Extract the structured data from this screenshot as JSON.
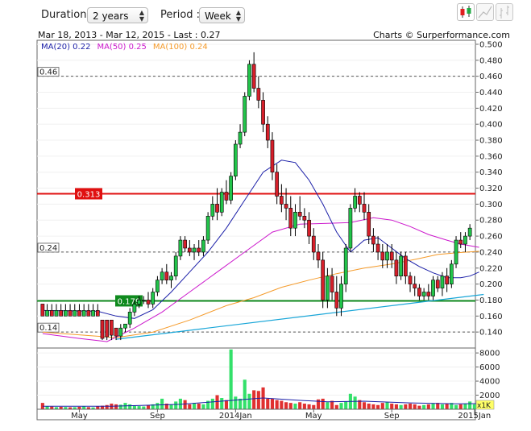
{
  "toolbar": {
    "duration_label": "Duration :",
    "duration_value": "2 years",
    "period_label": "Period :",
    "period_value": "Week",
    "chart_type_icons": [
      "candlestick-icon",
      "line-chart-icon",
      "bar-chart-icon"
    ]
  },
  "header": {
    "range_text": "Mar 18, 2013 - Mar 12, 2015 - Last : 0.27",
    "credit_text": "Charts © Surperformance.com"
  },
  "colors": {
    "up": "#22c44a",
    "down": "#d61f2a",
    "ma20": "#1b1fa8",
    "ma50": "#cc18cc",
    "ma100": "#f59b2b",
    "trend": "#19a6d8",
    "resistance": "#e01010",
    "support": "#0f8a1e"
  },
  "chart_data": {
    "type": "candlestick",
    "title": "",
    "legend": [
      {
        "name": "MA(20)",
        "value": "0.22",
        "color": "#1b1fa8"
      },
      {
        "name": "MA(50)",
        "value": "0.25",
        "color": "#cc18cc"
      },
      {
        "name": "MA(100)",
        "value": "0.24",
        "color": "#f59b2b"
      }
    ],
    "ylim": [
      0.12,
      0.505
    ],
    "y_ticks": [
      "0.500",
      "0.480",
      "0.460",
      "0.440",
      "0.420",
      "0.400",
      "0.380",
      "0.360",
      "0.340",
      "0.320",
      "0.300",
      "0.280",
      "0.260",
      "0.240",
      "0.220",
      "0.200",
      "0.180",
      "0.160",
      "0.140"
    ],
    "y_tick_values": [
      0.5,
      0.48,
      0.46,
      0.44,
      0.42,
      0.4,
      0.38,
      0.36,
      0.34,
      0.32,
      0.3,
      0.28,
      0.26,
      0.24,
      0.22,
      0.2,
      0.18,
      0.16,
      0.14
    ],
    "x_labels": [
      {
        "label": "May",
        "week": 8
      },
      {
        "label": "Sep",
        "week": 25
      },
      {
        "label": "2014Jan",
        "week": 42
      },
      {
        "label": "May",
        "week": 59
      },
      {
        "label": "Sep",
        "week": 76
      },
      {
        "label": "2015Jan",
        "week": 94
      }
    ],
    "dashed_levels": [
      {
        "label": "0.46",
        "value": 0.46
      },
      {
        "label": "0.24",
        "value": 0.24
      },
      {
        "label": "0.14",
        "value": 0.14
      }
    ],
    "resistance": {
      "label": "0.313",
      "value": 0.313
    },
    "support": {
      "label": "0.179",
      "value": 0.179
    },
    "weekly_ohlc": [
      [
        0.175,
        0.175,
        0.16,
        0.16
      ],
      [
        0.16,
        0.175,
        0.16,
        0.167
      ],
      [
        0.167,
        0.175,
        0.16,
        0.16
      ],
      [
        0.16,
        0.175,
        0.16,
        0.167
      ],
      [
        0.167,
        0.175,
        0.16,
        0.16
      ],
      [
        0.16,
        0.175,
        0.16,
        0.167
      ],
      [
        0.167,
        0.175,
        0.16,
        0.16
      ],
      [
        0.16,
        0.175,
        0.16,
        0.167
      ],
      [
        0.167,
        0.175,
        0.16,
        0.16
      ],
      [
        0.16,
        0.175,
        0.16,
        0.167
      ],
      [
        0.167,
        0.175,
        0.16,
        0.16
      ],
      [
        0.16,
        0.175,
        0.16,
        0.167
      ],
      [
        0.167,
        0.175,
        0.16,
        0.16
      ],
      [
        0.155,
        0.155,
        0.13,
        0.132
      ],
      [
        0.155,
        0.155,
        0.13,
        0.134
      ],
      [
        0.155,
        0.155,
        0.13,
        0.136
      ],
      [
        0.145,
        0.145,
        0.13,
        0.135
      ],
      [
        0.135,
        0.15,
        0.13,
        0.145
      ],
      [
        0.145,
        0.15,
        0.14,
        0.15
      ],
      [
        0.15,
        0.17,
        0.145,
        0.165
      ],
      [
        0.165,
        0.18,
        0.16,
        0.175
      ],
      [
        0.175,
        0.185,
        0.17,
        0.18
      ],
      [
        0.18,
        0.185,
        0.175,
        0.18
      ],
      [
        0.18,
        0.19,
        0.17,
        0.175
      ],
      [
        0.175,
        0.195,
        0.17,
        0.19
      ],
      [
        0.19,
        0.21,
        0.185,
        0.205
      ],
      [
        0.205,
        0.22,
        0.2,
        0.215
      ],
      [
        0.215,
        0.225,
        0.2,
        0.205
      ],
      [
        0.205,
        0.215,
        0.195,
        0.21
      ],
      [
        0.21,
        0.24,
        0.205,
        0.235
      ],
      [
        0.235,
        0.26,
        0.23,
        0.255
      ],
      [
        0.255,
        0.26,
        0.24,
        0.245
      ],
      [
        0.245,
        0.255,
        0.235,
        0.24
      ],
      [
        0.24,
        0.25,
        0.23,
        0.245
      ],
      [
        0.245,
        0.255,
        0.235,
        0.24
      ],
      [
        0.24,
        0.26,
        0.235,
        0.255
      ],
      [
        0.255,
        0.29,
        0.25,
        0.285
      ],
      [
        0.285,
        0.31,
        0.28,
        0.3
      ],
      [
        0.3,
        0.32,
        0.28,
        0.29
      ],
      [
        0.29,
        0.32,
        0.285,
        0.315
      ],
      [
        0.315,
        0.33,
        0.3,
        0.305
      ],
      [
        0.305,
        0.34,
        0.3,
        0.335
      ],
      [
        0.335,
        0.38,
        0.33,
        0.375
      ],
      [
        0.375,
        0.4,
        0.37,
        0.39
      ],
      [
        0.39,
        0.44,
        0.385,
        0.435
      ],
      [
        0.435,
        0.48,
        0.43,
        0.475
      ],
      [
        0.475,
        0.49,
        0.44,
        0.445
      ],
      [
        0.445,
        0.46,
        0.42,
        0.43
      ],
      [
        0.43,
        0.44,
        0.39,
        0.4
      ],
      [
        0.4,
        0.41,
        0.37,
        0.38
      ],
      [
        0.38,
        0.39,
        0.33,
        0.34
      ],
      [
        0.34,
        0.35,
        0.3,
        0.31
      ],
      [
        0.31,
        0.325,
        0.29,
        0.3
      ],
      [
        0.3,
        0.32,
        0.28,
        0.295
      ],
      [
        0.295,
        0.31,
        0.26,
        0.27
      ],
      [
        0.27,
        0.3,
        0.26,
        0.29
      ],
      [
        0.29,
        0.31,
        0.28,
        0.285
      ],
      [
        0.285,
        0.295,
        0.27,
        0.28
      ],
      [
        0.28,
        0.29,
        0.25,
        0.26
      ],
      [
        0.26,
        0.27,
        0.23,
        0.24
      ],
      [
        0.24,
        0.25,
        0.22,
        0.23
      ],
      [
        0.23,
        0.24,
        0.17,
        0.18
      ],
      [
        0.18,
        0.22,
        0.17,
        0.21
      ],
      [
        0.21,
        0.22,
        0.18,
        0.19
      ],
      [
        0.19,
        0.21,
        0.16,
        0.17
      ],
      [
        0.17,
        0.21,
        0.16,
        0.2
      ],
      [
        0.2,
        0.25,
        0.19,
        0.245
      ],
      [
        0.245,
        0.3,
        0.24,
        0.295
      ],
      [
        0.295,
        0.32,
        0.29,
        0.31
      ],
      [
        0.31,
        0.315,
        0.29,
        0.3
      ],
      [
        0.3,
        0.315,
        0.28,
        0.29
      ],
      [
        0.29,
        0.3,
        0.25,
        0.26
      ],
      [
        0.26,
        0.27,
        0.24,
        0.25
      ],
      [
        0.25,
        0.26,
        0.23,
        0.24
      ],
      [
        0.24,
        0.25,
        0.22,
        0.23
      ],
      [
        0.23,
        0.25,
        0.22,
        0.24
      ],
      [
        0.24,
        0.25,
        0.22,
        0.23
      ],
      [
        0.23,
        0.24,
        0.2,
        0.21
      ],
      [
        0.21,
        0.24,
        0.205,
        0.235
      ],
      [
        0.235,
        0.24,
        0.2,
        0.21
      ],
      [
        0.21,
        0.215,
        0.19,
        0.2
      ],
      [
        0.2,
        0.21,
        0.185,
        0.195
      ],
      [
        0.195,
        0.2,
        0.18,
        0.185
      ],
      [
        0.185,
        0.195,
        0.18,
        0.19
      ],
      [
        0.19,
        0.2,
        0.18,
        0.185
      ],
      [
        0.185,
        0.21,
        0.18,
        0.205
      ],
      [
        0.205,
        0.21,
        0.19,
        0.195
      ],
      [
        0.195,
        0.215,
        0.185,
        0.21
      ],
      [
        0.21,
        0.22,
        0.19,
        0.2
      ],
      [
        0.2,
        0.23,
        0.195,
        0.225
      ],
      [
        0.225,
        0.26,
        0.22,
        0.255
      ],
      [
        0.255,
        0.265,
        0.245,
        0.25
      ],
      [
        0.25,
        0.265,
        0.24,
        0.26
      ],
      [
        0.26,
        0.275,
        0.255,
        0.27
      ]
    ],
    "ma20": [
      [
        0,
        0.167
      ],
      [
        12,
        0.166
      ],
      [
        16,
        0.16
      ],
      [
        20,
        0.157
      ],
      [
        24,
        0.168
      ],
      [
        28,
        0.19
      ],
      [
        32,
        0.215
      ],
      [
        36,
        0.24
      ],
      [
        40,
        0.27
      ],
      [
        44,
        0.305
      ],
      [
        48,
        0.34
      ],
      [
        52,
        0.355
      ],
      [
        55,
        0.352
      ],
      [
        58,
        0.33
      ],
      [
        61,
        0.3
      ],
      [
        64,
        0.265
      ],
      [
        67,
        0.24
      ],
      [
        70,
        0.255
      ],
      [
        73,
        0.258
      ],
      [
        76,
        0.245
      ],
      [
        79,
        0.232
      ],
      [
        82,
        0.222
      ],
      [
        85,
        0.214
      ],
      [
        88,
        0.208
      ],
      [
        91,
        0.208
      ],
      [
        93,
        0.21
      ],
      [
        95,
        0.215
      ]
    ],
    "ma50": [
      [
        0,
        0.138
      ],
      [
        8,
        0.132
      ],
      [
        14,
        0.128
      ],
      [
        20,
        0.145
      ],
      [
        26,
        0.165
      ],
      [
        32,
        0.19
      ],
      [
        38,
        0.215
      ],
      [
        44,
        0.24
      ],
      [
        50,
        0.265
      ],
      [
        56,
        0.275
      ],
      [
        62,
        0.276
      ],
      [
        67,
        0.277
      ],
      [
        72,
        0.283
      ],
      [
        76,
        0.28
      ],
      [
        80,
        0.272
      ],
      [
        84,
        0.262
      ],
      [
        88,
        0.255
      ],
      [
        91,
        0.25
      ],
      [
        95,
        0.246
      ]
    ],
    "ma100": [
      [
        0,
        0.14
      ],
      [
        16,
        0.133
      ],
      [
        24,
        0.14
      ],
      [
        32,
        0.155
      ],
      [
        40,
        0.173
      ],
      [
        46,
        0.183
      ],
      [
        52,
        0.196
      ],
      [
        58,
        0.205
      ],
      [
        64,
        0.213
      ],
      [
        70,
        0.22
      ],
      [
        76,
        0.225
      ],
      [
        82,
        0.232
      ],
      [
        86,
        0.237
      ],
      [
        90,
        0.239
      ],
      [
        95,
        0.241
      ]
    ],
    "trendline": [
      [
        16,
        0.131
      ],
      [
        96,
        0.187
      ]
    ],
    "volume": {
      "ticks": [
        "8000",
        "6000",
        "4000",
        "2000"
      ],
      "tick_values": [
        8000,
        6000,
        4000,
        2000
      ],
      "unit": "x1K",
      "ylim": [
        0,
        8700
      ],
      "values": [
        900,
        450,
        380,
        300,
        350,
        320,
        280,
        300,
        350,
        420,
        300,
        260,
        400,
        500,
        600,
        800,
        700,
        650,
        900,
        700,
        500,
        450,
        400,
        600,
        700,
        900,
        1500,
        800,
        700,
        1100,
        1500,
        1300,
        700,
        900,
        800,
        700,
        1200,
        1500,
        2000,
        1600,
        1300,
        8500,
        1800,
        1500,
        4200,
        2200,
        2700,
        2600,
        3100,
        1500,
        1500,
        1300,
        1200,
        1000,
        900,
        800,
        1000,
        800,
        700,
        600,
        1400,
        1500,
        1000,
        1200,
        600,
        900,
        1100,
        2200,
        1800,
        1300,
        1000,
        800,
        700,
        600,
        900,
        1000,
        800,
        700,
        600,
        700,
        800,
        700,
        500,
        600,
        700,
        800,
        900,
        700,
        800,
        900,
        600,
        700,
        800,
        1100,
        700,
        1200
      ],
      "avg": [
        [
          0,
          420
        ],
        [
          15,
          430
        ],
        [
          30,
          700
        ],
        [
          40,
          1200
        ],
        [
          48,
          1600
        ],
        [
          55,
          1300
        ],
        [
          62,
          1050
        ],
        [
          70,
          1150
        ],
        [
          80,
          900
        ],
        [
          90,
          780
        ],
        [
          95,
          800
        ]
      ]
    }
  }
}
